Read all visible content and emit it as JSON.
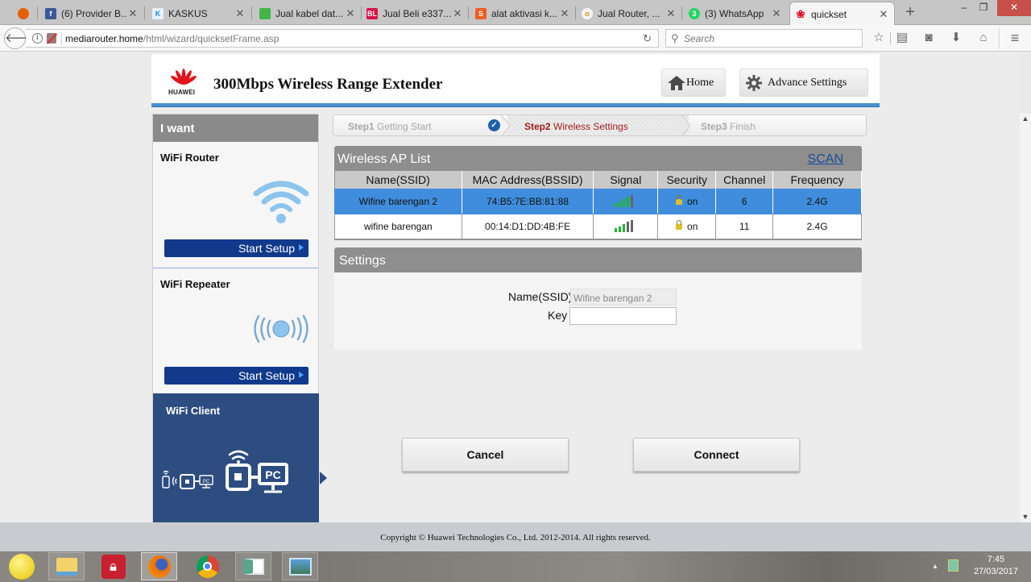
{
  "browser": {
    "tabs": [
      {
        "title": "",
        "icon": "firefox-icon",
        "color": "#e66000"
      },
      {
        "title": "(6) Provider B...",
        "icon": "facebook-icon",
        "color": "#3b5998"
      },
      {
        "title": "KASKUS",
        "icon": "kaskus-icon",
        "color": "#1e88e5"
      },
      {
        "title": "Jual kabel dat...",
        "icon": "tokopedia-icon",
        "color": "#42b549"
      },
      {
        "title": "Jual Beli e337...",
        "icon": "bukalapak-icon",
        "color": "#d71149"
      },
      {
        "title": "alat aktivasi k...",
        "icon": "shopee-icon",
        "color": "#f05d23"
      },
      {
        "title": "Jual Router, ...",
        "icon": "olx-icon",
        "color": "#ffffff"
      },
      {
        "title": "(3) WhatsApp",
        "icon": "whatsapp-icon",
        "color": "#25d366"
      },
      {
        "title": "quickset",
        "icon": "huawei-icon",
        "color": "#e3001b"
      }
    ],
    "active_tab": 8,
    "url_host": "mediarouter.home",
    "url_path": "/html/wizard/quicksetFrame.asp",
    "search_placeholder": "Search",
    "window_controls": {
      "minimize": "–",
      "restore": "❐",
      "close": "✕"
    }
  },
  "header": {
    "brand": "HUAWEI",
    "product_title": "300Mbps Wireless Range Extender",
    "home_label": "Home",
    "advance_label": "Advance Settings"
  },
  "sidebar": {
    "heading": "I want",
    "sections": [
      {
        "title": "WiFi Router",
        "button": "Start Setup"
      },
      {
        "title": "WiFi Repeater",
        "button": "Start Setup"
      },
      {
        "title": "WiFi Client",
        "selected": true
      }
    ],
    "client_label_small": "PC",
    "client_label_large": "PC"
  },
  "steps": [
    {
      "num": "Step1",
      "label": "Getting Start",
      "state": "done"
    },
    {
      "num": "Step2",
      "label": "Wireless Settings",
      "state": "current"
    },
    {
      "num": "Step3",
      "label": "Finish",
      "state": "pending"
    }
  ],
  "ap_list": {
    "title": "Wireless AP List",
    "scan_label": "SCAN",
    "columns": [
      "Name(SSID)",
      "MAC Address(BSSID)",
      "Signal",
      "Security",
      "Channel",
      "Frequency"
    ],
    "rows": [
      {
        "ssid": "Wifine barengan 2",
        "mac": "74:B5:7E:BB:81:88",
        "signal_bars": 4,
        "signal_max": 5,
        "security": "on",
        "channel": "6",
        "frequency": "2.4G",
        "selected": true
      },
      {
        "ssid": "wifine barengan",
        "mac": "00:14:D1:DD:4B:FE",
        "signal_bars": 3,
        "signal_max": 5,
        "security": "on",
        "channel": "11",
        "frequency": "2.4G",
        "selected": false
      }
    ]
  },
  "settings": {
    "title": "Settings",
    "ssid_label": "Name(SSID)",
    "ssid_value": "Wifine barengan 2",
    "key_label": "Key",
    "key_value": ""
  },
  "actions": {
    "cancel": "Cancel",
    "connect": "Connect"
  },
  "footer": {
    "copyright": "Copyright © Huawei Technologies Co., Ltd. 2012-2014. All rights reserved."
  },
  "taskbar": {
    "apps": [
      "smiley-app",
      "file-explorer",
      "lock-app",
      "firefox",
      "chrome",
      "app-window",
      "photos"
    ],
    "time": "7:45",
    "date": "27/03/2017"
  },
  "colors": {
    "accent_blue": "#3f8ddc",
    "nav_blue": "#113a8c",
    "client_bg": "#2d4d80",
    "step_current": "#a01c1c"
  }
}
